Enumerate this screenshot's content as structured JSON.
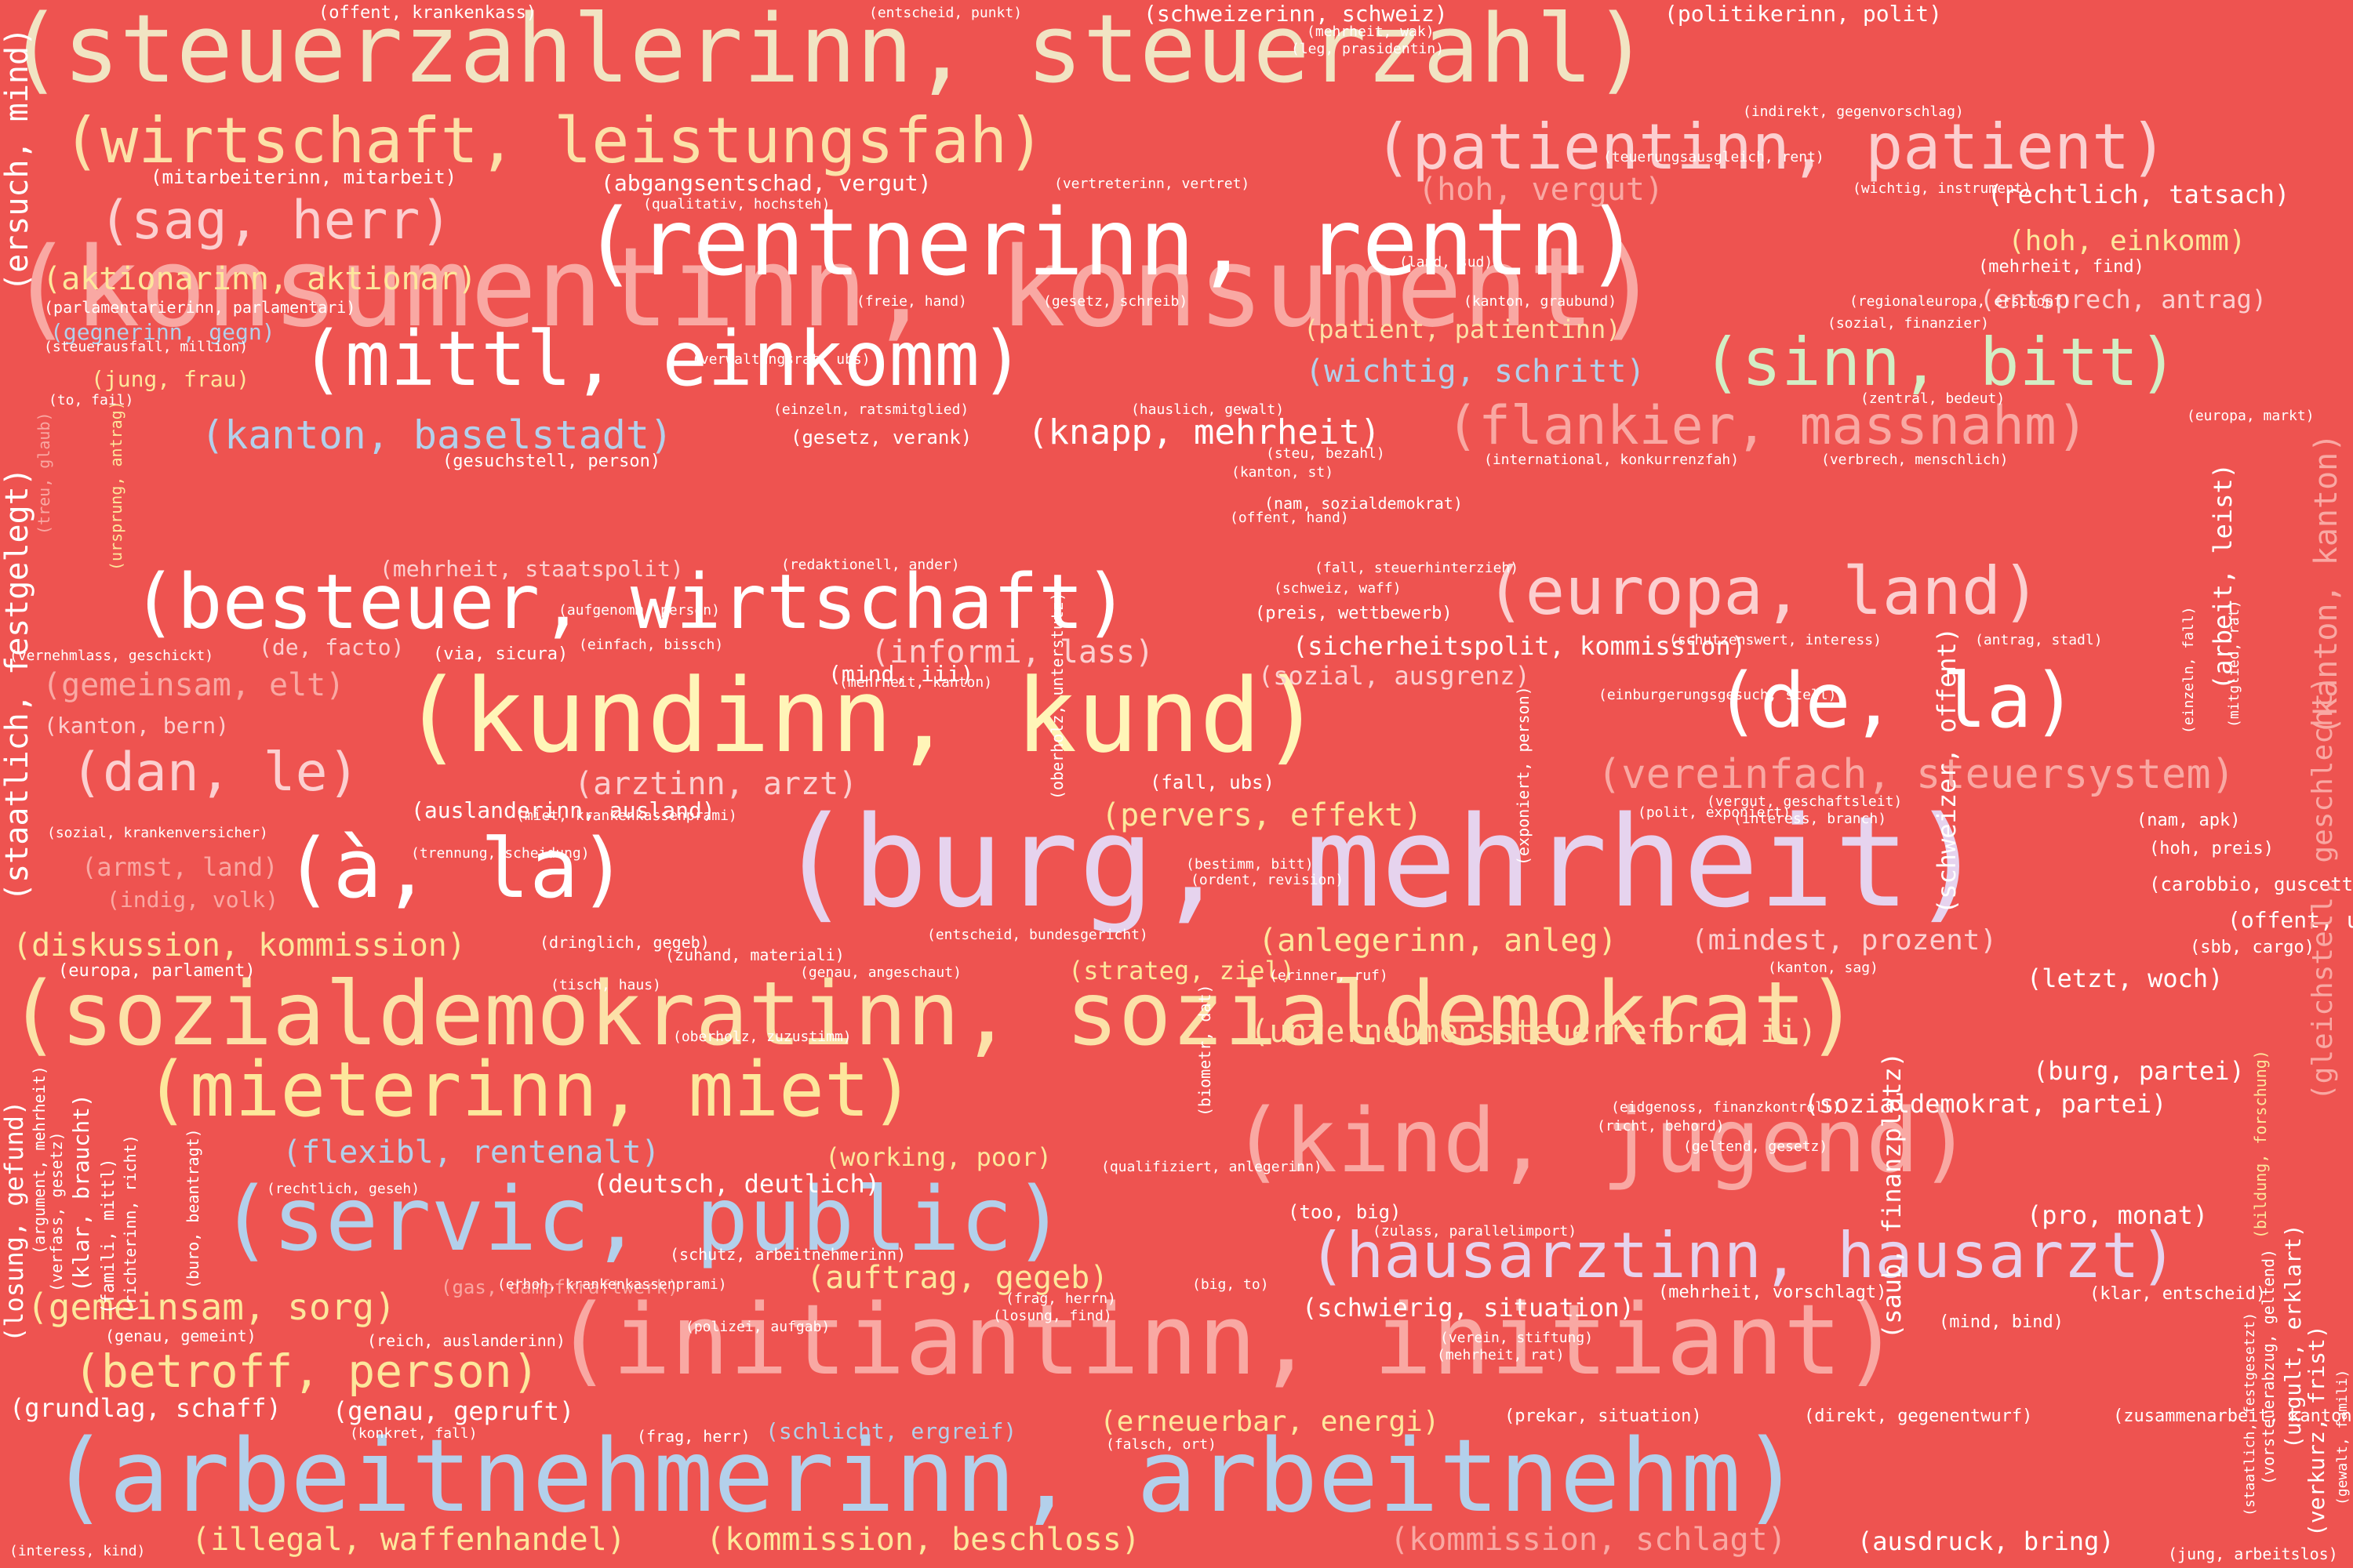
{
  "palette": {
    "background": "#ee5350",
    "cream": "#f1e4c3",
    "white": "#ffffff",
    "lightyellow": "#fff5b8",
    "peach": "#fce1a8",
    "yellow": "#fde79c",
    "pink": "#fccfd0",
    "salmon": "#f9a8a3",
    "lavender": "#e6d3ee",
    "blue": "#b3d0eb",
    "green": "#d3eec5"
  },
  "words": [
    {
      "text": "(steuerzahlerinn, steuerzahl)",
      "color": "#f1e4c3"
    },
    {
      "text": "(konsumentinn, konsument)",
      "color": "#f9a8a3"
    },
    {
      "text": "(burg, mehrheit)",
      "color": "#e6d3ee"
    },
    {
      "text": "(arbeitnehmerinn, arbeitnehm)",
      "color": "#b3d0eb"
    },
    {
      "text": "(sozialdemokratinn, sozialdemokrat)",
      "color": "#fce1a8"
    },
    {
      "text": "(rentnerinn, rentn)",
      "color": "#ffffff"
    },
    {
      "text": "(initiantinn, initiant)",
      "color": "#f9a8a3"
    },
    {
      "text": "(kundinn, kund)",
      "color": "#fff5b8"
    },
    {
      "text": "(kind, jugend)",
      "color": "#f9a8a3"
    },
    {
      "text": "(servic, public)",
      "color": "#b3d0eb"
    },
    {
      "text": "(mittl, einkomm)",
      "color": "#ffffff"
    },
    {
      "text": "(besteuer, wirtschaft)",
      "color": "#ffffff"
    },
    {
      "text": "(mieterinn, miet)",
      "color": "#fde79c"
    },
    {
      "text": "(wirtschaft, leistungsfah)",
      "color": "#fce1a8"
    },
    {
      "text": "(à, la)",
      "color": "#ffffff"
    },
    {
      "text": "(de, la)",
      "color": "#ffffff"
    },
    {
      "text": "(europa, land)",
      "color": "#fccfd0"
    },
    {
      "text": "(patientinn, patient)",
      "color": "#fccfd0"
    },
    {
      "text": "(hausarztinn, hausarzt)",
      "color": "#e6d3ee"
    },
    {
      "text": "(sinn, bitt)",
      "color": "#d3eec5"
    },
    {
      "text": "(flankier, massnahm)",
      "color": "#f9a8a3"
    },
    {
      "text": "(sag, herr)",
      "color": "#fccfd0"
    },
    {
      "text": "(dan, le)",
      "color": "#fccfd0"
    },
    {
      "text": "(vereinfach, steuersystem)",
      "color": "#f9a8a3"
    },
    {
      "text": "(betroff, person)",
      "color": "#fde79c"
    },
    {
      "text": "(gemeinsam, sorg)",
      "color": "#fde79c"
    },
    {
      "text": "(kanton, baselstadt)",
      "color": "#b3d0eb"
    },
    {
      "text": "(knapp, mehrheit)",
      "color": "#ffffff"
    },
    {
      "text": "(unternehmenssteuerreform, ii)",
      "color": "#fce1a8"
    },
    {
      "text": "(diskussion, kommission)",
      "color": "#fde79c"
    },
    {
      "text": "(flexibl, rentenalt)",
      "color": "#b3d0eb"
    },
    {
      "text": "(informi, lass)",
      "color": "#fccfd0"
    },
    {
      "text": "(arztinn, arzt)",
      "color": "#fccfd0"
    },
    {
      "text": "(pervers, effekt)",
      "color": "#fde79c"
    },
    {
      "text": "(anlegerinn, anleg)",
      "color": "#fde79c"
    },
    {
      "text": "(mindest, prozent)",
      "color": "#fccfd0"
    },
    {
      "text": "(auftrag, gegeb)",
      "color": "#fde79c"
    },
    {
      "text": "(schwierig, situation)",
      "color": "#ffffff"
    },
    {
      "text": "(erneuerbar, energi)",
      "color": "#fde79c"
    },
    {
      "text": "(illegal, waffenhandel)",
      "color": "#fde79c"
    },
    {
      "text": "(kommission, beschloss)",
      "color": "#fde79c"
    },
    {
      "text": "(kommission, schlagt)",
      "color": "#f9a8a3"
    },
    {
      "text": "(ausdruck, bring)",
      "color": "#ffffff"
    },
    {
      "text": "(hoh, vergut)",
      "color": "#f9a8a3"
    },
    {
      "text": "(hoh, einkomm)",
      "color": "#fde79c"
    },
    {
      "text": "(rechtlich, tatsach)",
      "color": "#ffffff"
    },
    {
      "text": "(aktionarinn, aktionar)",
      "color": "#fde79c"
    },
    {
      "text": "(wichtig, schritt)",
      "color": "#b3d0eb"
    },
    {
      "text": "(patient, patientinn)",
      "color": "#fce1a8"
    },
    {
      "text": "(entsprech, antrag)",
      "color": "#fccfd0"
    },
    {
      "text": "(gemeinsam, elt)",
      "color": "#f9a8a3"
    },
    {
      "text": "(sicherheitspolit, kommission)",
      "color": "#ffffff"
    },
    {
      "text": "(sozial, ausgrenz)",
      "color": "#fccfd0"
    },
    {
      "text": "(strateg, ziel)",
      "color": "#fde79c"
    },
    {
      "text": "(letzt, woch)",
      "color": "#ffffff"
    },
    {
      "text": "(burg, partei)",
      "color": "#ffffff"
    },
    {
      "text": "(sozialdemokrat, partei)",
      "color": "#ffffff"
    },
    {
      "text": "(pro, monat)",
      "color": "#ffffff"
    },
    {
      "text": "(working, poor)",
      "color": "#fde79c"
    },
    {
      "text": "(deutsch, deutlich)",
      "color": "#ffffff"
    },
    {
      "text": "(genau, gepruft)",
      "color": "#ffffff"
    },
    {
      "text": "(grundlag, schaff)",
      "color": "#ffffff"
    },
    {
      "text": "(mehrheit, staatspolit)",
      "color": "#fccfd0"
    },
    {
      "text": "(auslanderinn, ausland)",
      "color": "#ffffff"
    },
    {
      "text": "(kanton, bern)",
      "color": "#fccfd0"
    },
    {
      "text": "(de, facto)",
      "color": "#fccfd0"
    },
    {
      "text": "(mind, iii)",
      "color": "#ffffff"
    },
    {
      "text": "(armst, land)",
      "color": "#f9a8a3"
    },
    {
      "text": "(indig, volk)",
      "color": "#f9a8a3"
    },
    {
      "text": "(jung, frau)",
      "color": "#fde79c"
    },
    {
      "text": "(gegnerinn, gegn)",
      "color": "#b3d0eb"
    },
    {
      "text": "(mitarbeiterinn, mitarbeit)",
      "color": "#ffffff"
    },
    {
      "text": "(abgangsentschad, vergut)",
      "color": "#ffffff"
    },
    {
      "text": "(schlicht, ergreif)",
      "color": "#b3d0eb"
    },
    {
      "text": "(gas, dampfkraftwerk)",
      "color": "#f9a8a3"
    },
    {
      "text": "(offent, krankenkass)",
      "color": "#ffffff"
    },
    {
      "text": "(entscheid, punkt)",
      "color": "#ffffff"
    },
    {
      "text": "(schweizerinn, schweiz)",
      "color": "#ffffff"
    },
    {
      "text": "(politikerinn, polit)",
      "color": "#ffffff"
    },
    {
      "text": "(mehrheit, wak)",
      "color": "#ffffff"
    },
    {
      "text": "(leg, prasidentin)",
      "color": "#ffffff"
    },
    {
      "text": "(indirekt, gegenvorschlag)",
      "color": "#ffffff"
    },
    {
      "text": "(qualitativ, hochsteh)",
      "color": "#ffffff"
    },
    {
      "text": "(vertreterinn, vertret)",
      "color": "#ffffff"
    },
    {
      "text": "(teuerungsausgleich, rent)",
      "color": "#ffffff"
    },
    {
      "text": "(wichtig, instrument)",
      "color": "#ffffff"
    },
    {
      "text": "(land, sud)",
      "color": "#ffffff"
    },
    {
      "text": "(mehrheit, find)",
      "color": "#ffffff"
    },
    {
      "text": "(parlamentarierinn, parlamentari)",
      "color": "#ffffff"
    },
    {
      "text": "(freie, hand)",
      "color": "#ffffff"
    },
    {
      "text": "(gesetz, schreib)",
      "color": "#ffffff"
    },
    {
      "text": "(kanton, graubund)",
      "color": "#ffffff"
    },
    {
      "text": "(regionaleuropa, erschopf)",
      "color": "#ffffff"
    },
    {
      "text": "(sozial, finanzier)",
      "color": "#ffffff"
    },
    {
      "text": "(steuerausfall, million)",
      "color": "#ffffff"
    },
    {
      "text": "(verwaltungsrat, ubs)",
      "color": "#ffffff"
    },
    {
      "text": "(to, fail)",
      "color": "#ffffff"
    },
    {
      "text": "(einzeln, ratsmitglied)",
      "color": "#ffffff"
    },
    {
      "text": "(hauslich, gewalt)",
      "color": "#ffffff"
    },
    {
      "text": "(zentral, bedeut)",
      "color": "#ffffff"
    },
    {
      "text": "(europa, markt)",
      "color": "#ffffff"
    },
    {
      "text": "(gesetz, verank)",
      "color": "#ffffff"
    },
    {
      "text": "(steu, bezahl)",
      "color": "#ffffff"
    },
    {
      "text": "(kanton, st)",
      "color": "#ffffff"
    },
    {
      "text": "(gesuchstell, person)",
      "color": "#ffffff"
    },
    {
      "text": "(international, konkurrenzfah)",
      "color": "#ffffff"
    },
    {
      "text": "(verbrech, menschlich)",
      "color": "#ffffff"
    },
    {
      "text": "(nam, sozialdemokrat)",
      "color": "#ffffff"
    },
    {
      "text": "(offent, hand)",
      "color": "#ffffff"
    },
    {
      "text": "(redaktionell, ander)",
      "color": "#ffffff"
    },
    {
      "text": "(fall, steuerhinterzieh)",
      "color": "#ffffff"
    },
    {
      "text": "(schweiz, waff)",
      "color": "#ffffff"
    },
    {
      "text": "(preis, wettbewerb)",
      "color": "#ffffff"
    },
    {
      "text": "(aufgenomm, person)",
      "color": "#ffffff"
    },
    {
      "text": "(via, sicura)",
      "color": "#ffffff"
    },
    {
      "text": "(einfach, bissch)",
      "color": "#ffffff"
    },
    {
      "text": "(vernehmlass, geschickt)",
      "color": "#ffffff"
    },
    {
      "text": "(schutzenswert, interess)",
      "color": "#ffffff"
    },
    {
      "text": "(antrag, stadl)",
      "color": "#ffffff"
    },
    {
      "text": "(mehrheit, kanton)",
      "color": "#ffffff"
    },
    {
      "text": "(einburgerungsgesuch, stell)",
      "color": "#ffffff"
    },
    {
      "text": "(fall, ubs)",
      "color": "#ffffff"
    },
    {
      "text": "(sozial, krankenversicher)",
      "color": "#ffffff"
    },
    {
      "text": "(miet, krankenkassenprami)",
      "color": "#ffffff"
    },
    {
      "text": "(vergut, geschaftsleit)",
      "color": "#ffffff"
    },
    {
      "text": "(interess, branch)",
      "color": "#ffffff"
    },
    {
      "text": "(polit, exponiert)",
      "color": "#ffffff"
    },
    {
      "text": "(nam, apk)",
      "color": "#ffffff"
    },
    {
      "text": "(trennung, scheidung)",
      "color": "#ffffff"
    },
    {
      "text": "(hoh, preis)",
      "color": "#ffffff"
    },
    {
      "text": "(carobbio, guscetti)",
      "color": "#ffffff"
    },
    {
      "text": "(bestimm, bitt)",
      "color": "#ffffff"
    },
    {
      "text": "(ordent, revision)",
      "color": "#ffffff"
    },
    {
      "text": "(offent, unternehm)",
      "color": "#ffffff"
    },
    {
      "text": "(sbb, cargo)",
      "color": "#ffffff"
    },
    {
      "text": "(dringlich, gegeb)",
      "color": "#ffffff"
    },
    {
      "text": "(zuhand, materiali)",
      "color": "#ffffff"
    },
    {
      "text": "(entscheid, bundesgericht)",
      "color": "#ffffff"
    },
    {
      "text": "(europa, parlament)",
      "color": "#ffffff"
    },
    {
      "text": "(genau, angeschaut)",
      "color": "#ffffff"
    },
    {
      "text": "(kanton, sag)",
      "color": "#ffffff"
    },
    {
      "text": "(tisch, haus)",
      "color": "#ffffff"
    },
    {
      "text": "(erinner, ruf)",
      "color": "#ffffff"
    },
    {
      "text": "(oberholz, zuzustimm)",
      "color": "#ffffff"
    },
    {
      "text": "(eidgenoss, finanzkontroll)",
      "color": "#ffffff"
    },
    {
      "text": "(richt, behord)",
      "color": "#ffffff"
    },
    {
      "text": "(geltend, gesetz)",
      "color": "#ffffff"
    },
    {
      "text": "(rechtlich, geseh)",
      "color": "#ffffff"
    },
    {
      "text": "(qualifiziert, anlegerinn)",
      "color": "#ffffff"
    },
    {
      "text": "(too, big)",
      "color": "#ffffff"
    },
    {
      "text": "(zulass, parallelimport)",
      "color": "#ffffff"
    },
    {
      "text": "(schutz, arbeitnehmerinn)",
      "color": "#ffffff"
    },
    {
      "text": "(big, to)",
      "color": "#ffffff"
    },
    {
      "text": "(frag, herrn)",
      "color": "#ffffff"
    },
    {
      "text": "(mehrheit, vorschlagt)",
      "color": "#ffffff"
    },
    {
      "text": "(klar, entscheid)",
      "color": "#ffffff"
    },
    {
      "text": "(erhoh, krankenkassenprami)",
      "color": "#ffffff"
    },
    {
      "text": "(losung, find)",
      "color": "#ffffff"
    },
    {
      "text": "(genau, gemeint)",
      "color": "#ffffff"
    },
    {
      "text": "(reich, auslanderinn)",
      "color": "#ffffff"
    },
    {
      "text": "(polizei, aufgab)",
      "color": "#ffffff"
    },
    {
      "text": "(mind, bind)",
      "color": "#ffffff"
    },
    {
      "text": "(verein, stiftung)",
      "color": "#ffffff"
    },
    {
      "text": "(mehrheit, rat)",
      "color": "#ffffff"
    },
    {
      "text": "(prekar, situation)",
      "color": "#ffffff"
    },
    {
      "text": "(direkt, gegenentwurf)",
      "color": "#ffffff"
    },
    {
      "text": "(zusammenarbeit, kanton)",
      "color": "#ffffff"
    },
    {
      "text": "(konkret, fall)",
      "color": "#ffffff"
    },
    {
      "text": "(frag, herr)",
      "color": "#ffffff"
    },
    {
      "text": "(falsch, ort)",
      "color": "#ffffff"
    },
    {
      "text": "(interess, kind)",
      "color": "#ffffff"
    },
    {
      "text": "(jung, arbeitslos)",
      "color": "#ffffff"
    },
    {
      "text": "(ersuch, mind)",
      "color": "#ffffff"
    },
    {
      "text": "(treu, glaub)",
      "color": "#f9a8a3"
    },
    {
      "text": "(staatlich, festgelegt)",
      "color": "#ffffff"
    },
    {
      "text": "(ursprung, antrag)",
      "color": "#fde79c"
    },
    {
      "text": "(losung, gefund)",
      "color": "#ffffff"
    },
    {
      "text": "(argument, mehrheit)",
      "color": "#ffffff"
    },
    {
      "text": "(verfass, gesetz)",
      "color": "#ffffff"
    },
    {
      "text": "(klar, braucht)",
      "color": "#ffffff"
    },
    {
      "text": "(famili, mittl)",
      "color": "#ffffff"
    },
    {
      "text": "(richterinn, richt)",
      "color": "#ffffff"
    },
    {
      "text": "(buro, beantragt)",
      "color": "#ffffff"
    },
    {
      "text": "(biometr, dat)",
      "color": "#ffffff"
    },
    {
      "text": "(exponiert, person)",
      "color": "#ffffff"
    },
    {
      "text": "(oberholz, unterstutz)",
      "color": "#ffffff"
    },
    {
      "text": "(einzeln, fall)",
      "color": "#ffffff"
    },
    {
      "text": "(schweizer, offent)",
      "color": "#ffffff"
    },
    {
      "text": "(saub, finanzplatz)",
      "color": "#ffffff"
    },
    {
      "text": "(mitglied, rat)",
      "color": "#ffffff"
    },
    {
      "text": "(arbeit, leist)",
      "color": "#ffffff"
    },
    {
      "text": "(kanton, kanton)",
      "color": "#f9a8a3"
    },
    {
      "text": "(gleichstell, geschlecht)",
      "color": "#f9a8a3"
    },
    {
      "text": "(bildung, forschung)",
      "color": "#fde79c"
    },
    {
      "text": "(staatlich, festgesetzt)",
      "color": "#ffffff"
    },
    {
      "text": "(vorsteuerabzug, geltend)",
      "color": "#ffffff"
    },
    {
      "text": "(ungult, erklart)",
      "color": "#ffffff"
    },
    {
      "text": "(verkurz, frist)",
      "color": "#ffffff"
    },
    {
      "text": "(gewalt, famili)",
      "color": "#ffffff"
    },
    {
      "text": "(schutz, arbeitnehmerinn)",
      "color": "#ffffff"
    }
  ]
}
